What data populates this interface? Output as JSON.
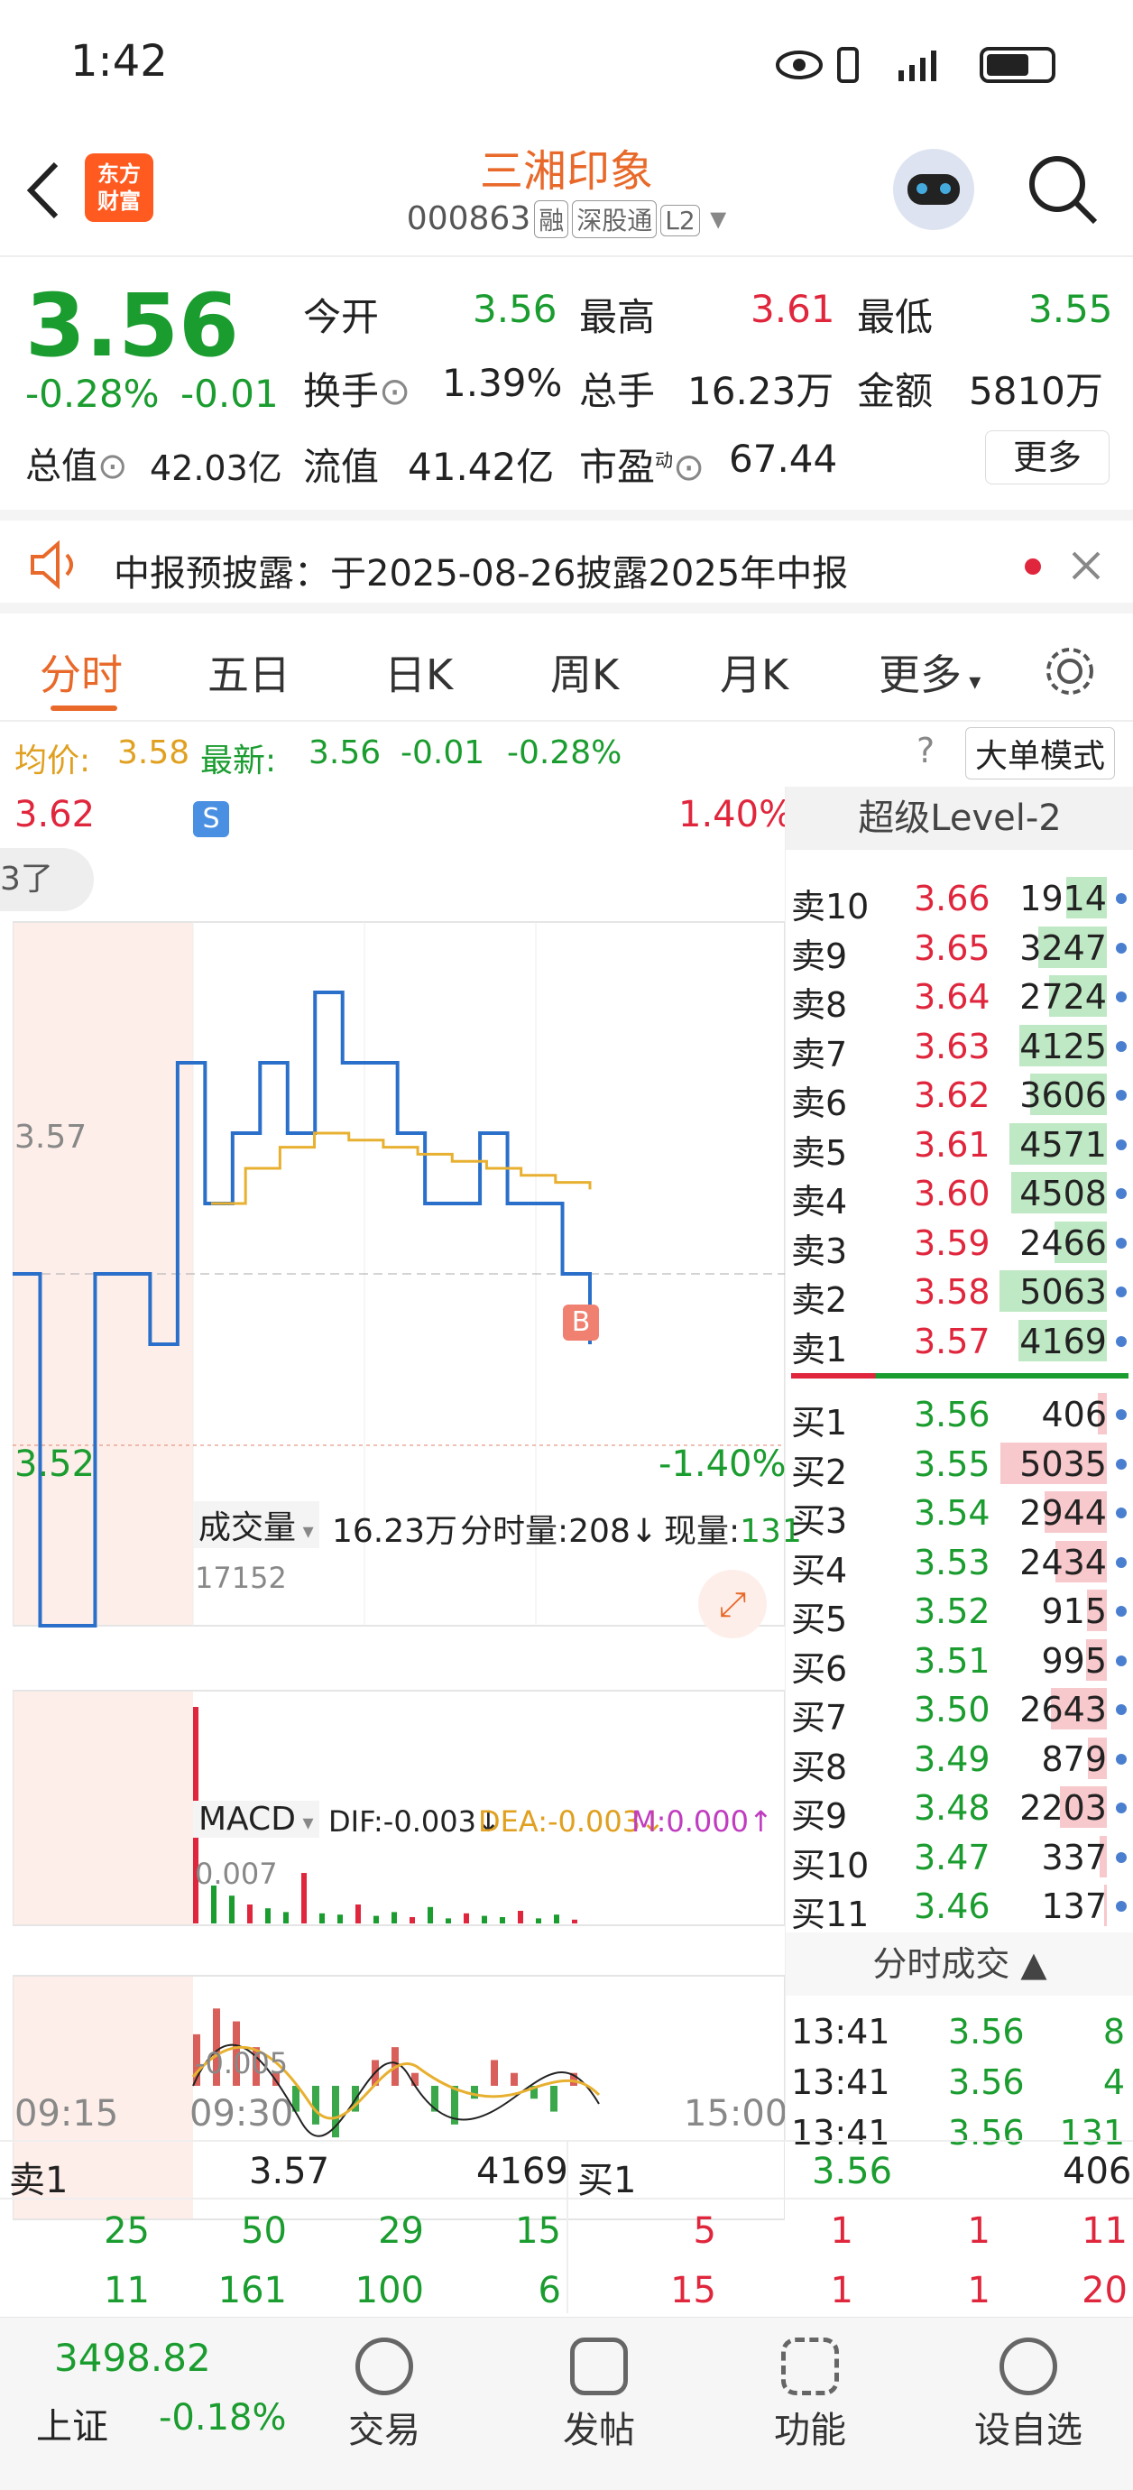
{
  "status": {
    "time": "1:42"
  },
  "header": {
    "stock_name": "三湘印象",
    "code": "000863",
    "tags": [
      "融",
      "深股通",
      "L2"
    ]
  },
  "quote": {
    "price": "3.56",
    "pct": "-0.28%",
    "chg": "-0.01",
    "open_label": "今开",
    "open": "3.56",
    "high_label": "最高",
    "high": "3.61",
    "low_label": "最低",
    "low": "3.55",
    "turnover_label": "换手",
    "turnover": "1.39%",
    "vol_label": "总手",
    "vol": "16.23万",
    "amount_label": "金额",
    "amount": "5810万",
    "mktcap_label": "总值",
    "mktcap": "42.03亿",
    "float_label": "流值",
    "float": "41.42亿",
    "pe_label": "市盈",
    "pe_sup": "动",
    "pe": "67.44",
    "more": "更多"
  },
  "notice": {
    "text": "中报预披露：于2025-08-26披露2025年中报"
  },
  "tabs": [
    "分时",
    "五日",
    "日K",
    "周K",
    "月K",
    "更多"
  ],
  "infobar": {
    "avg_label": "均价:",
    "avg": "3.58",
    "latest_label": "最新:",
    "latest": "3.56",
    "chg": "-0.01",
    "pct": "-0.28%",
    "mode": "大单模式"
  },
  "chart": {
    "top_price": "3.62",
    "bottom_price": "3.52",
    "mid_price": "3.57",
    "top_pct": "1.40%",
    "bottom_pct": "-1.40%",
    "bubble": "3了",
    "vol_label": "成交量",
    "vol_total": "16.23万",
    "fs_vol": "分时量:208",
    "now_vol_label": "现量:",
    "now_vol": "131",
    "vol_max": "17152",
    "macd_label": "MACD",
    "dif": "DIF:-0.003",
    "dea": "DEA:-0.003",
    "m": "M:0.000",
    "macd_top": "0.007",
    "macd_bottom": "-0.005",
    "t_start": "09:15",
    "t_open": "09:30",
    "t_end": "15:00",
    "marker_s": "S",
    "marker_b": "B",
    "price_line": [
      3.57,
      3.52,
      3.52,
      3.57,
      3.57,
      3.56,
      3.6,
      3.58,
      3.59,
      3.6,
      3.59,
      3.61,
      3.6,
      3.6,
      3.59,
      3.58,
      3.58,
      3.59,
      3.58,
      3.58,
      3.57,
      3.56
    ],
    "avg_line": [
      3.58,
      3.585,
      3.588,
      3.59,
      3.589,
      3.588,
      3.587,
      3.586,
      3.585,
      3.584,
      3.583,
      3.582
    ],
    "vol_bars": [
      17152,
      3000,
      2200,
      1500,
      1200,
      900,
      4000,
      800,
      700,
      1500,
      600,
      900,
      500,
      1300,
      400,
      800,
      600,
      500,
      1000,
      400,
      700,
      300
    ],
    "macd_bars": [
      0.004,
      0.006,
      0.005,
      0.003,
      0.001,
      -0.002,
      -0.003,
      -0.004,
      -0.002,
      0.002,
      0.003,
      0.001,
      -0.002,
      -0.003,
      -0.001,
      0.002,
      0.001,
      -0.001,
      -0.002,
      0.001
    ]
  },
  "level2": {
    "title": "超级Level-2",
    "asks": [
      {
        "l": "卖10",
        "p": "3.66",
        "v": "1914"
      },
      {
        "l": "卖9",
        "p": "3.65",
        "v": "3247"
      },
      {
        "l": "卖8",
        "p": "3.64",
        "v": "2724"
      },
      {
        "l": "卖7",
        "p": "3.63",
        "v": "4125"
      },
      {
        "l": "卖6",
        "p": "3.62",
        "v": "3606"
      },
      {
        "l": "卖5",
        "p": "3.61",
        "v": "4571"
      },
      {
        "l": "卖4",
        "p": "3.60",
        "v": "4508"
      },
      {
        "l": "卖3",
        "p": "3.59",
        "v": "2466"
      },
      {
        "l": "卖2",
        "p": "3.58",
        "v": "5063"
      },
      {
        "l": "卖1",
        "p": "3.57",
        "v": "4169"
      }
    ],
    "bids": [
      {
        "l": "买1",
        "p": "3.56",
        "v": "406"
      },
      {
        "l": "买2",
        "p": "3.55",
        "v": "5035"
      },
      {
        "l": "买3",
        "p": "3.54",
        "v": "2944"
      },
      {
        "l": "买4",
        "p": "3.53",
        "v": "2434"
      },
      {
        "l": "买5",
        "p": "3.52",
        "v": "915"
      },
      {
        "l": "买6",
        "p": "3.51",
        "v": "995"
      },
      {
        "l": "买7",
        "p": "3.50",
        "v": "2643"
      },
      {
        "l": "买8",
        "p": "3.49",
        "v": "879"
      },
      {
        "l": "买9",
        "p": "3.48",
        "v": "2203"
      },
      {
        "l": "买10",
        "p": "3.47",
        "v": "337"
      },
      {
        "l": "买11",
        "p": "3.46",
        "v": "137"
      }
    ],
    "trades_title": "分时成交",
    "trades": [
      {
        "t": "13:41",
        "p": "3.56",
        "v": "8"
      },
      {
        "t": "13:41",
        "p": "3.56",
        "v": "4"
      },
      {
        "t": "13:41",
        "p": "3.56",
        "v": "131"
      }
    ]
  },
  "bottom": {
    "ask_label": "卖1",
    "ask_price": "3.57",
    "ask_vol": "4169",
    "bid_label": "买1",
    "bid_price": "3.56",
    "bid_vol": "406",
    "ask_rows": [
      [
        "25",
        "50",
        "29",
        "15"
      ],
      [
        "11",
        "161",
        "100",
        "6"
      ]
    ],
    "bid_rows": [
      [
        "5",
        "1",
        "1",
        "11"
      ],
      [
        "15",
        "1",
        "1",
        "20"
      ]
    ]
  },
  "nav": {
    "index_value": "3498.82",
    "index_name": "上证",
    "index_pct": "-0.18%",
    "items": [
      "交易",
      "发帖",
      "功能",
      "设自选"
    ]
  }
}
